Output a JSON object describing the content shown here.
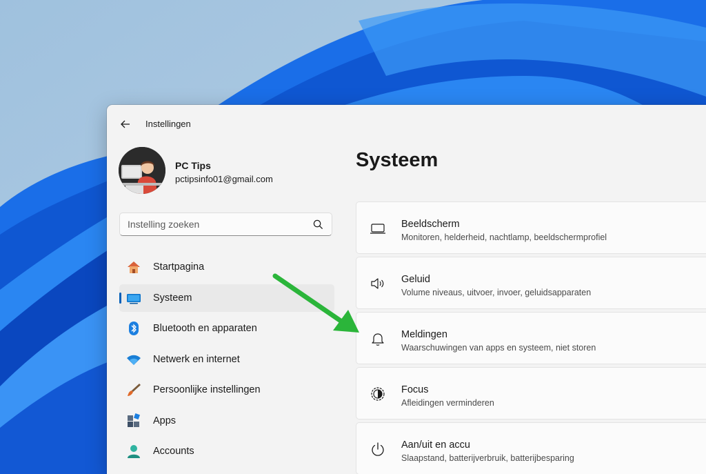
{
  "window": {
    "title": "Instellingen"
  },
  "profile": {
    "name": "PC Tips",
    "email": "pctipsinfo01@gmail.com"
  },
  "search": {
    "placeholder": "Instelling zoeken"
  },
  "sidebar": {
    "items": [
      {
        "label": "Startpagina",
        "icon": "home-icon"
      },
      {
        "label": "Systeem",
        "icon": "monitor-icon",
        "selected": true
      },
      {
        "label": "Bluetooth en apparaten",
        "icon": "bluetooth-icon"
      },
      {
        "label": "Netwerk en internet",
        "icon": "wifi-icon"
      },
      {
        "label": "Persoonlijke instellingen",
        "icon": "paintbrush-icon"
      },
      {
        "label": "Apps",
        "icon": "apps-icon"
      },
      {
        "label": "Accounts",
        "icon": "person-icon"
      }
    ]
  },
  "main": {
    "title": "Systeem",
    "cards": [
      {
        "title": "Beeldscherm",
        "description": "Monitoren, helderheid, nachtlamp, beeldschermprofiel",
        "icon": "display-icon"
      },
      {
        "title": "Geluid",
        "description": "Volume niveaus, uitvoer, invoer, geluidsapparaten",
        "icon": "speaker-icon"
      },
      {
        "title": "Meldingen",
        "description": "Waarschuwingen van apps en systeem, niet storen",
        "icon": "bell-icon"
      },
      {
        "title": "Focus",
        "description": "Afleidingen verminderen",
        "icon": "focus-icon"
      },
      {
        "title": "Aan/uit en accu",
        "description": "Slaapstand, batterijverbruik, batterijbesparing",
        "icon": "power-icon"
      }
    ]
  },
  "colors": {
    "accent": "#005fb8",
    "arrow": "#2bb53a",
    "wallpaper_blue": "#1565e0"
  }
}
